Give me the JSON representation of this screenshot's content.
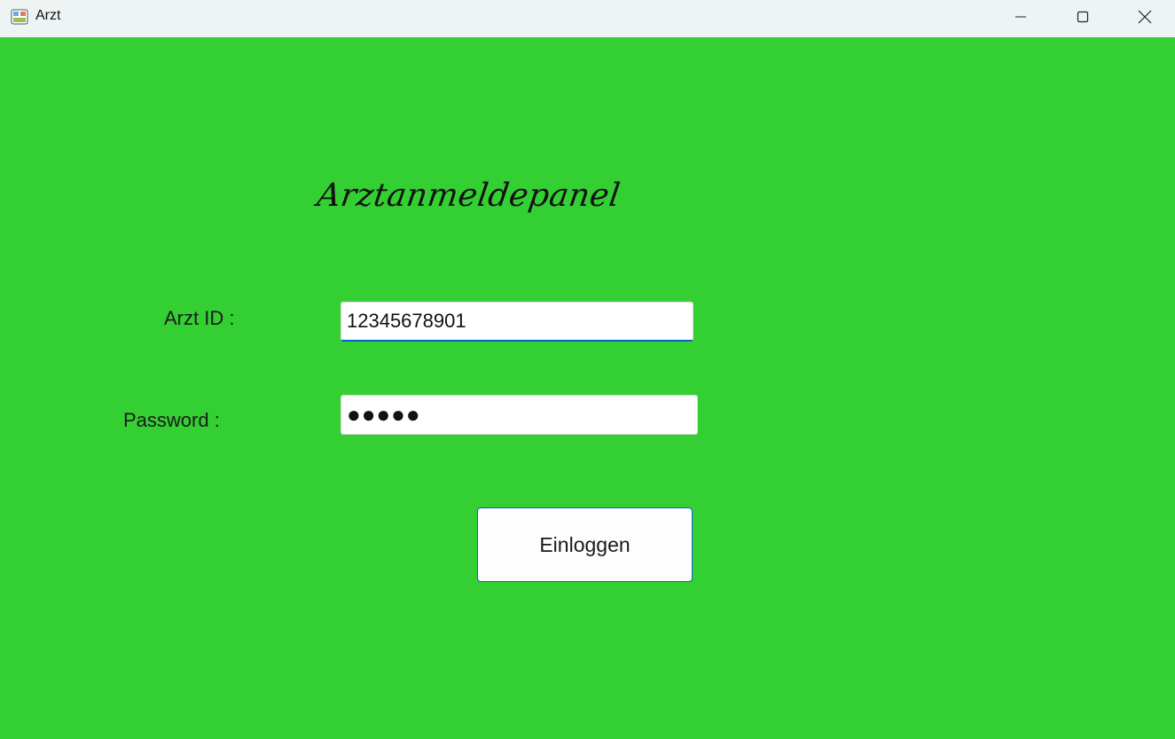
{
  "window": {
    "title": "Arzt",
    "controls": {
      "minimize": "minimize-icon",
      "maximize": "maximize-icon",
      "close": "close-icon"
    }
  },
  "panel": {
    "title": "Arztanmeldepanel",
    "arzt_id_label": "Arzt ID :",
    "arzt_id_value": "12345678901",
    "password_label": "Password :",
    "password_value": "●●●●●",
    "login_button": "Einloggen"
  },
  "colors": {
    "background": "#33cf33",
    "titlebar": "#eef4f4",
    "accent": "#0067c0"
  }
}
